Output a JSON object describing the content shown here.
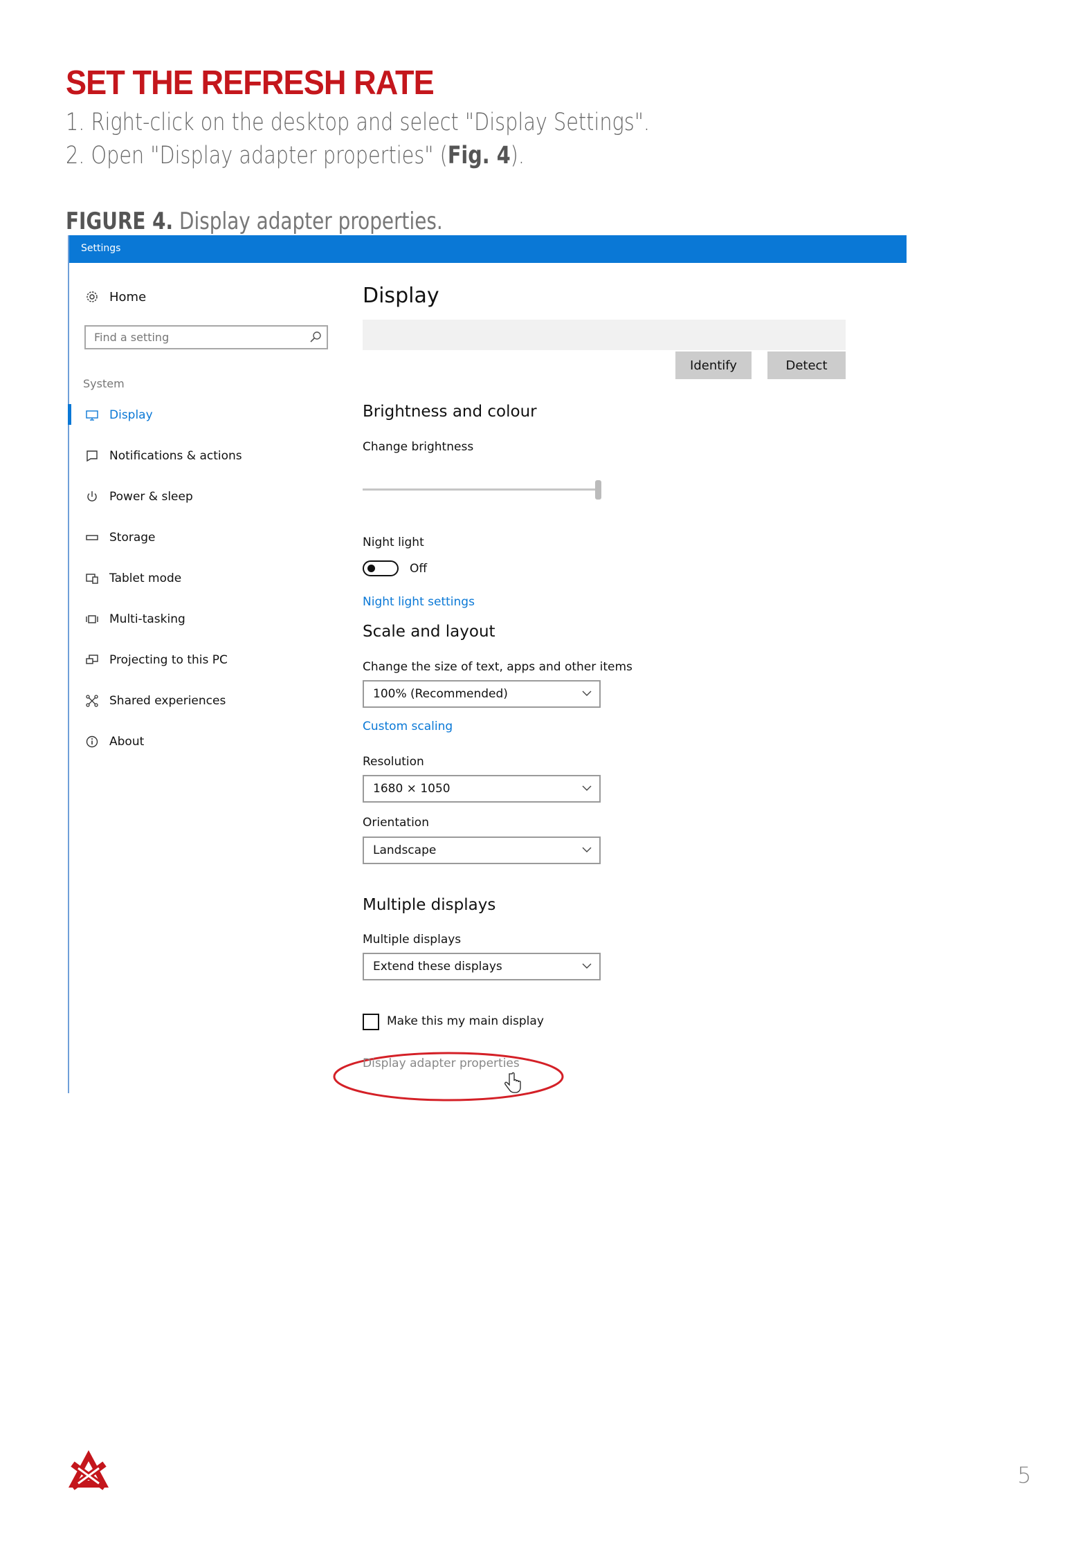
{
  "document": {
    "title": "SET THE REFRESH RATE",
    "steps": [
      {
        "prefix": "1. Right-click on the desktop and select \"Display Settings\".",
        "bold": "",
        "suffix": ""
      },
      {
        "prefix": "2. Open \"Display adapter properties\" (",
        "bold": "Fig. 4",
        "suffix": ")."
      }
    ],
    "figure_label": "FIGURE 4.",
    "figure_caption": " Display adapter properties.",
    "page_number": "5"
  },
  "window": {
    "title": "Settings"
  },
  "sidebar": {
    "home_label": "Home",
    "search_placeholder": "Find a setting",
    "section_label": "System",
    "items": [
      {
        "label": "Display",
        "icon": "monitor-icon",
        "active": true
      },
      {
        "label": "Notifications & actions",
        "icon": "notification-icon"
      },
      {
        "label": "Power & sleep",
        "icon": "power-icon"
      },
      {
        "label": "Storage",
        "icon": "storage-icon"
      },
      {
        "label": "Tablet mode",
        "icon": "tablet-icon"
      },
      {
        "label": "Multi-tasking",
        "icon": "multitask-icon"
      },
      {
        "label": "Projecting to this PC",
        "icon": "projector-icon"
      },
      {
        "label": "Shared experiences",
        "icon": "share-icon"
      },
      {
        "label": "About",
        "icon": "info-icon"
      }
    ]
  },
  "content": {
    "title": "Display",
    "identify_label": "Identify",
    "detect_label": "Detect",
    "brightness": {
      "heading": "Brightness and colour",
      "change_label": "Change brightness",
      "level": 1.0,
      "night_light_label": "Night light",
      "night_light_state": "Off",
      "night_light_link": "Night light settings"
    },
    "scale": {
      "heading": "Scale and layout",
      "size_label": "Change the size of text, apps and other items",
      "size_value": "100% (Recommended)",
      "custom_link": "Custom scaling",
      "resolution_label": "Resolution",
      "resolution_value": "1680 × 1050",
      "orientation_label": "Orientation",
      "orientation_value": "Landscape"
    },
    "multiple": {
      "heading": "Multiple displays",
      "label": "Multiple displays",
      "value": "Extend these displays",
      "main_display_label": "Make this my main display",
      "adapter_link": "Display adapter properties"
    }
  },
  "colors": {
    "accent": "#0a78d6",
    "title_red": "#c4161c",
    "highlight_ellipse": "#d42027"
  }
}
